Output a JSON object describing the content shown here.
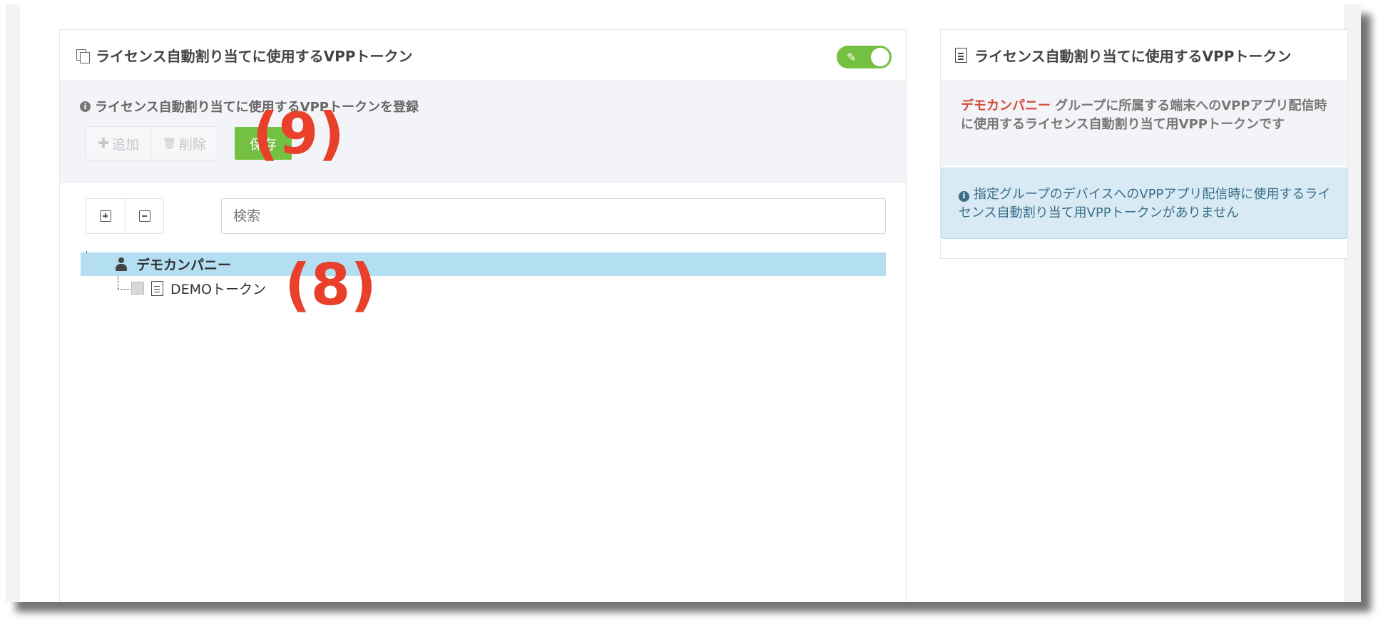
{
  "left_panel": {
    "title": "ライセンス自動割り当てに使用するVPPトークン",
    "toolbar_info": "ライセンス自動割り当てに使用するVPPトークンを登録",
    "buttons": {
      "add": "追加",
      "delete": "削除",
      "save": "保存"
    },
    "search": {
      "placeholder": "検索"
    },
    "tree": {
      "root": "デモカンパニー",
      "children": [
        "DEMOトークン"
      ]
    },
    "annotations": {
      "save": "(9)",
      "tree": "(8)"
    }
  },
  "right_panel": {
    "title": "ライセンス自動割り当てに使用するVPPトークン",
    "company": "デモカンパニー",
    "description": "グループに所属する端末へのVPPアプリ配信時に使用するライセンス自動割り当て用VPPトークンです",
    "alert": "指定グループのデバイスへのVPPアプリ配信時に使用するライセンス自動割り当て用VPPトークンがありません"
  },
  "colors": {
    "accent_green": "#74c042",
    "selected_row": "#b4def2",
    "annotation_red": "#e8402a",
    "company_red": "#d64a3a",
    "alert_bg": "#d8ebf5"
  },
  "icons": [
    "copy-icon",
    "edit-icon",
    "info-icon",
    "plus-icon",
    "trash-icon",
    "expand-icon",
    "collapse-icon",
    "user-icon",
    "document-icon",
    "checkbox-icon"
  ]
}
